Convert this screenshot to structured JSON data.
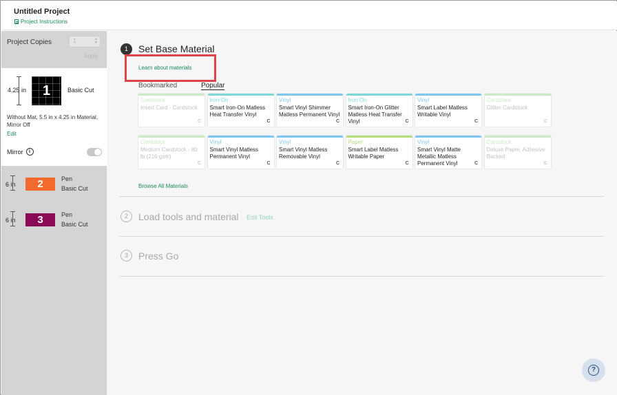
{
  "header": {
    "title": "Untitled Project",
    "instructions_label": "Project Instructions"
  },
  "sidebar": {
    "copies_label": "Project Copies",
    "copies_value": "1",
    "apply_label": "Apply",
    "mats": [
      {
        "number": "1",
        "dimension": "4.25 in",
        "cut": "Basic Cut",
        "info": "Without Mat, 5.5 in x 4.25 in Material, Mirror Off",
        "edit_label": "Edit",
        "mirror_label": "Mirror",
        "color": "#000000"
      },
      {
        "number": "2",
        "dimension": "6 in",
        "tool": "Pen",
        "cut": "Basic Cut",
        "color": "#f26a2e"
      },
      {
        "number": "3",
        "dimension": "6 in",
        "tool": "Pen",
        "cut": "Basic Cut",
        "color": "#8a0a56"
      }
    ]
  },
  "steps": [
    {
      "number": "1",
      "title": "Set Base Material",
      "learn_label": "Learn about materials",
      "tabs": [
        "Bookmarked",
        "Popular"
      ],
      "browse_label": "Browse All Materials",
      "materials": [
        {
          "category": "Cardstock",
          "name": "Insert Card - Cardstock",
          "color": "#a8dca0",
          "faded": true
        },
        {
          "category": "Iron-On",
          "name": "Smart Iron-On Matless Heat Transfer Vinyl",
          "color": "#7fd8d8",
          "faded": false
        },
        {
          "category": "Vinyl",
          "name": "Smart Vinyl Shimmer Matless Permanent Vinyl",
          "color": "#7cc8ee",
          "faded": false
        },
        {
          "category": "Iron-On",
          "name": "Smart Iron-On Glitter Matless Heat Transfer Vinyl",
          "color": "#7fd8d8",
          "faded": false
        },
        {
          "category": "Vinyl",
          "name": "Smart Label Matless Writable Vinyl",
          "color": "#7cc8ee",
          "faded": false
        },
        {
          "category": "Cardstock",
          "name": "Glitter Cardstock",
          "color": "#a8dca0",
          "faded": true
        },
        {
          "category": "Cardstock",
          "name": "Medium Cardstock - 80 lb (216 gsm)",
          "color": "#a8dca0",
          "faded": true
        },
        {
          "category": "Vinyl",
          "name": "Smart Vinyl Matless Permanent Vinyl",
          "color": "#7cc8ee",
          "faded": false
        },
        {
          "category": "Vinyl",
          "name": "Smart Vinyl Matless Removable Vinyl",
          "color": "#7cc8ee",
          "faded": false
        },
        {
          "category": "Paper",
          "name": "Smart Label Matless Writable Paper",
          "color": "#b4de7c",
          "faded": false
        },
        {
          "category": "Vinyl",
          "name": "Smart Vinyl Matte Metallic Matless Permanent Vinyl",
          "color": "#7cc8ee",
          "faded": false
        },
        {
          "category": "Cardstock",
          "name": "Deluxe Paper, Adhesive Backed",
          "color": "#a8dca0",
          "faded": true
        }
      ]
    },
    {
      "number": "2",
      "title": "Load tools and material",
      "edit_tools_label": "Edit Tools"
    },
    {
      "number": "3",
      "title": "Press Go"
    }
  ],
  "accent_color": "#1a8a5a",
  "highlight_color": "#e0424a"
}
